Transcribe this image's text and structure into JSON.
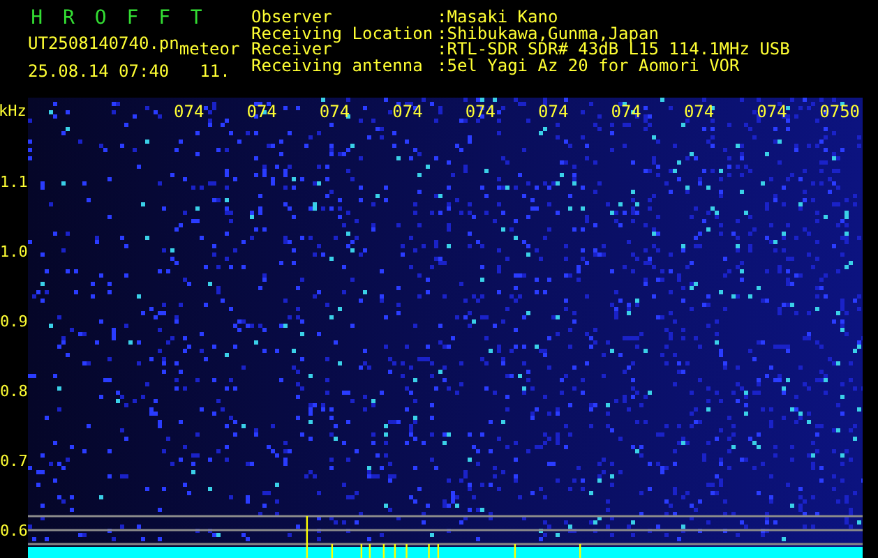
{
  "header": {
    "title": "H R O F F T",
    "file_name": "UT2508140740.pn",
    "mode": "meteor",
    "timestamp": "25.08.14 07:40",
    "count": "11.",
    "info": [
      {
        "label": "Observer",
        "value": ":Masaki Kano"
      },
      {
        "label": "Receiving Location",
        "value": ":Shibukawa,Gunma,Japan"
      },
      {
        "label": "Receiver",
        "value": ":RTL-SDR SDR# 43dB L15 114.1MHz USB"
      },
      {
        "label": "Receiving antenna",
        "value": ":5el Yagi Az 20 for Aomori VOR"
      }
    ]
  },
  "y_axis": {
    "unit": "kHz",
    "labels": [
      "1.1",
      "1.0",
      "0.9",
      "0.8",
      "0.7",
      "0.6"
    ]
  },
  "time_labels": [
    "074",
    "074",
    "074",
    "074",
    "074",
    "074",
    "074",
    "074",
    "074",
    "0750"
  ]
}
